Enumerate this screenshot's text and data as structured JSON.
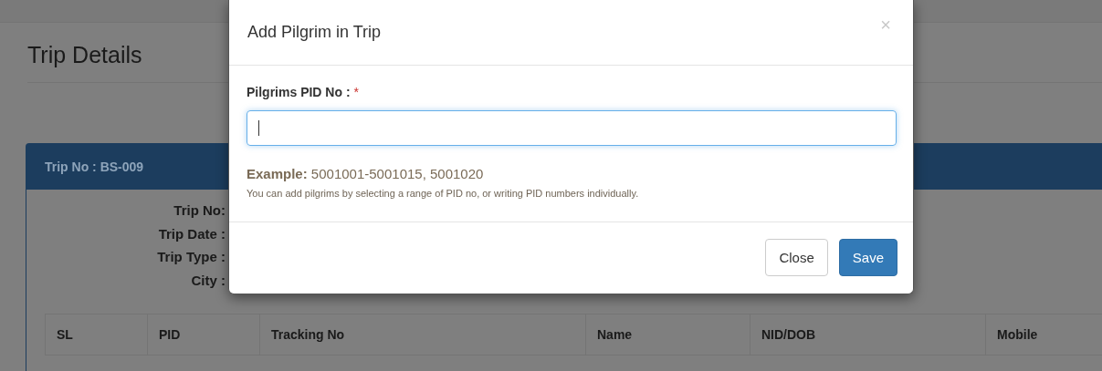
{
  "page": {
    "title": "Trip Details"
  },
  "panel": {
    "heading": "Trip No : BS-009",
    "info_labels": [
      "Trip No:",
      "Trip Date :",
      "Trip Type :",
      "City :"
    ],
    "table": {
      "columns": [
        "SL",
        "PID",
        "Tracking No",
        "Name",
        "NID/DOB",
        "Mobile"
      ]
    }
  },
  "modal": {
    "title": "Add Pilgrim in Trip",
    "close_icon": "×",
    "field": {
      "label": "Pilgrims PID No :",
      "required_mark": "*",
      "focused": true
    },
    "example": "**Example:** 5001001-5001015, 5001020",
    "help": "You can add pilgrims by selecting a range of PID no, or writing PID numbers individually.",
    "buttons": [
      {
        "label": "Close",
        "kind": "default"
      },
      {
        "label": "Save",
        "kind": "primary"
      }
    ]
  }
}
